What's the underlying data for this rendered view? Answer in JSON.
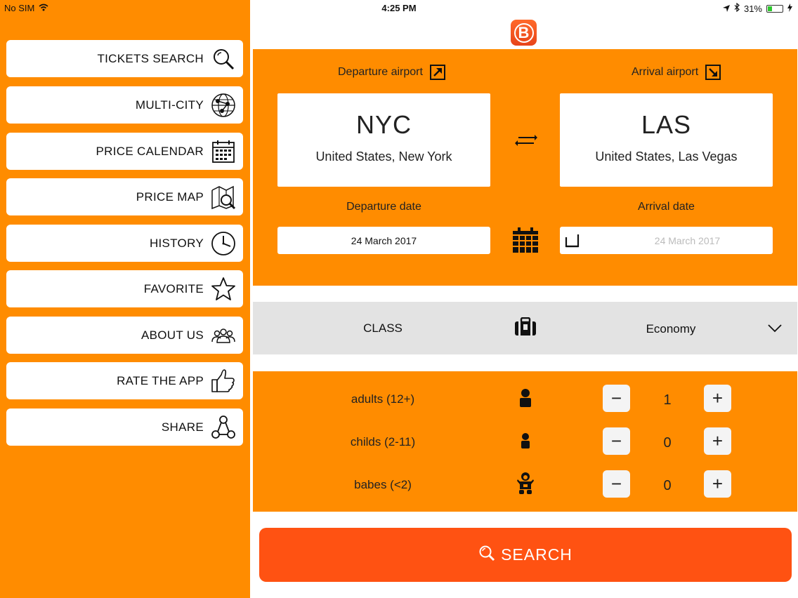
{
  "status_bar": {
    "carrier": "No SIM",
    "time": "4:25 PM",
    "battery": "31%",
    "battery_level": 0.31
  },
  "sidebar": {
    "items": [
      {
        "label": "TICKETS SEARCH",
        "icon": "search-icon"
      },
      {
        "label": "MULTI-CITY",
        "icon": "globe-network-icon"
      },
      {
        "label": "PRICE CALENDAR",
        "icon": "calendar-icon"
      },
      {
        "label": "PRICE MAP",
        "icon": "map-search-icon"
      },
      {
        "label": "HISTORY",
        "icon": "clock-icon"
      },
      {
        "label": "FAVORITE",
        "icon": "star-icon"
      },
      {
        "label": "ABOUT US",
        "icon": "group-icon"
      },
      {
        "label": "RATE THE APP",
        "icon": "thumbs-up-icon"
      },
      {
        "label": "SHARE",
        "icon": "share-icon"
      }
    ]
  },
  "app_logo_letter": "B",
  "route": {
    "departure_label": "Departure airport",
    "arrival_label": "Arrival airport",
    "departure": {
      "code": "NYC",
      "city": "United States, New York"
    },
    "arrival": {
      "code": "LAS",
      "city": "United States, Las Vegas"
    },
    "departure_date_label": "Departure date",
    "arrival_date_label": "Arrival date",
    "departure_date": "24 March 2017",
    "arrival_date": "24 March 2017"
  },
  "class_row": {
    "label": "CLASS",
    "value": "Economy"
  },
  "passengers": [
    {
      "label": "adults (12+)",
      "count": "1",
      "icon": "adult-icon"
    },
    {
      "label": "childs (2-11)",
      "count": "0",
      "icon": "child-icon"
    },
    {
      "label": "babes (<2)",
      "count": "0",
      "icon": "baby-icon"
    }
  ],
  "search_button": "SEARCH",
  "colors": {
    "primary": "#ff8c00",
    "search": "#ff5212",
    "class_bg": "#e3e3e3"
  }
}
